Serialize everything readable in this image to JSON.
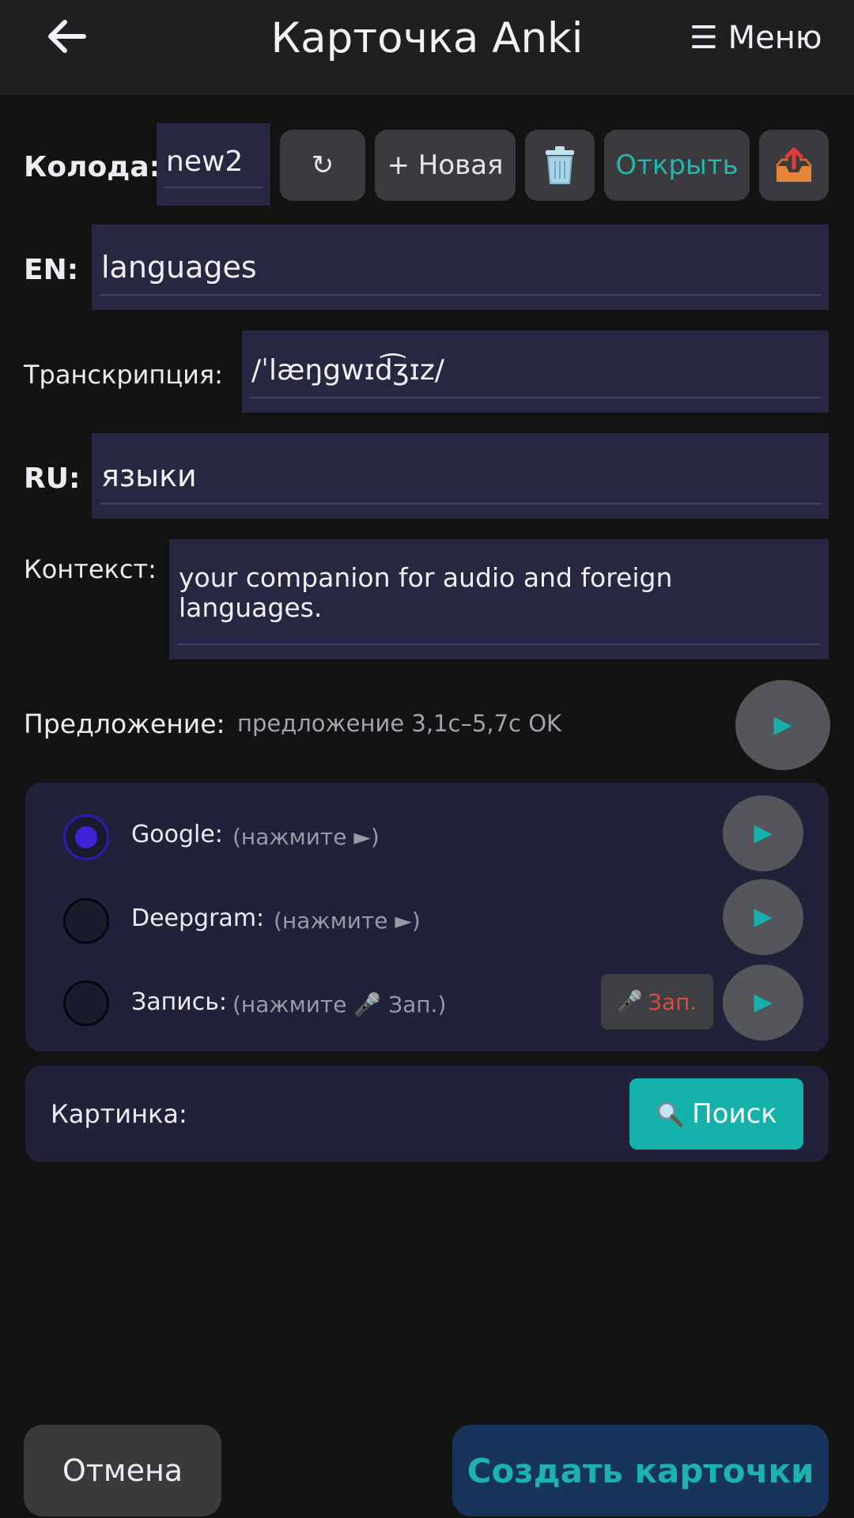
{
  "header": {
    "title": "Карточка Anki",
    "menu_label": "☰ Меню"
  },
  "deck": {
    "label": "Колода:",
    "value": "new2",
    "refresh_label": "↻",
    "new_label": "+ Новая",
    "open_label": "Открыть"
  },
  "fields": {
    "en_label": "EN:",
    "en_value": "languages",
    "transcription_label": "Транскрипция:",
    "transcription_value": "/ˈlæŋgwɪd͡ʒɪz/",
    "ru_label": "RU:",
    "ru_value": "языки",
    "context_label": "Контекст:",
    "context_value": "your companion for audio and foreign\nlanguages."
  },
  "sentence": {
    "label": "Предложение:",
    "status": "предложение 3,1с–5,7с OK"
  },
  "audio": {
    "options": [
      {
        "label": "Google:",
        "hint": "(нажмите ►)",
        "selected": true
      },
      {
        "label": "Deepgram:",
        "hint": "(нажмите ►)",
        "selected": false
      },
      {
        "label": "Запись:",
        "hint": "(нажмите 🎤 Зап.)",
        "selected": false
      }
    ],
    "record_label": "Зап."
  },
  "image": {
    "label": "Картинка:",
    "search_label": "Поиск"
  },
  "footer": {
    "cancel_label": "Отмена",
    "create_label": "Создать карточки"
  },
  "colors": {
    "accent_teal": "#14b2aa",
    "field_bg": "#272742",
    "panel_bg": "#21213a",
    "record_red": "#d94a44"
  }
}
